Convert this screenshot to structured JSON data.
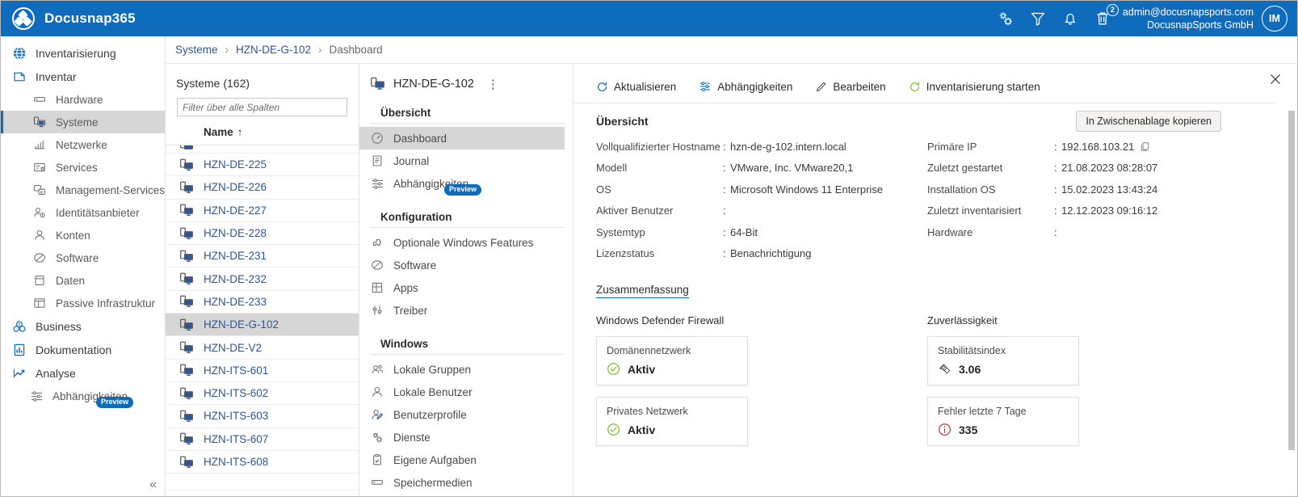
{
  "app": {
    "brand": "Docusnap365",
    "accent": "#0f6cbd"
  },
  "topbar": {
    "icons": [
      {
        "name": "settings-gear-icon",
        "label": "Einstellungen"
      },
      {
        "name": "filter-icon",
        "label": "Filter"
      },
      {
        "name": "bell-icon",
        "label": "Benachrichtigungen"
      },
      {
        "name": "trash-icon",
        "label": "Papierkorb",
        "badge": "2"
      }
    ],
    "account_email": "admin@docusnapsports.com",
    "account_company": "DocusnapSports GmbH",
    "avatar_initials": "IM"
  },
  "leftnav": {
    "items": [
      {
        "label": "Inventarisierung",
        "level": 1,
        "icon": "globe-icon",
        "selected": false
      },
      {
        "label": "Inventar",
        "level": 1,
        "icon": "inventory-icon",
        "selected": false
      },
      {
        "label": "Hardware",
        "level": 2,
        "icon": "hardware-icon",
        "selected": false
      },
      {
        "label": "Systeme",
        "level": 2,
        "icon": "system-icon",
        "selected": true
      },
      {
        "label": "Netzwerke",
        "level": 2,
        "icon": "network-icon",
        "selected": false
      },
      {
        "label": "Services",
        "level": 2,
        "icon": "services-icon",
        "selected": false
      },
      {
        "label": "Management-Services",
        "level": 2,
        "icon": "management-services-icon",
        "selected": false
      },
      {
        "label": "Identitätsanbieter",
        "level": 2,
        "icon": "identity-provider-icon",
        "selected": false
      },
      {
        "label": "Konten",
        "level": 2,
        "icon": "user-icon",
        "selected": false
      },
      {
        "label": "Software",
        "level": 2,
        "icon": "software-icon",
        "selected": false
      },
      {
        "label": "Daten",
        "level": 2,
        "icon": "data-icon",
        "selected": false
      },
      {
        "label": "Passive Infrastruktur",
        "level": 2,
        "icon": "passive-infrastructure-icon",
        "selected": false
      },
      {
        "label": "Business",
        "level": 1,
        "icon": "business-icon",
        "selected": false
      },
      {
        "label": "Dokumentation",
        "level": 1,
        "icon": "documentation-icon",
        "selected": false
      },
      {
        "label": "Analyse",
        "level": 1,
        "icon": "analysis-icon",
        "selected": false
      },
      {
        "label": "Abhängigkeiten",
        "level": 2,
        "icon": "dependencies-icon",
        "selected": false,
        "badge": "Preview"
      }
    ],
    "collapse_label": "«"
  },
  "breadcrumb": {
    "items": [
      {
        "label": "Systeme",
        "link": true
      },
      {
        "label": "HZN-DE-G-102",
        "link": true
      },
      {
        "label": "Dashboard",
        "link": false
      }
    ],
    "separator": "›"
  },
  "list_panel": {
    "title": "Systeme (162)",
    "filter_placeholder": "Filter über alle Spalten",
    "filter_value": "",
    "column_header": "Name",
    "sort_indicator": "↑",
    "rows": [
      {
        "name": "HZN-DE-225",
        "selected": false
      },
      {
        "name": "HZN-DE-226",
        "selected": false
      },
      {
        "name": "HZN-DE-227",
        "selected": false
      },
      {
        "name": "HZN-DE-228",
        "selected": false
      },
      {
        "name": "HZN-DE-231",
        "selected": false
      },
      {
        "name": "HZN-DE-232",
        "selected": false
      },
      {
        "name": "HZN-DE-233",
        "selected": false
      },
      {
        "name": "HZN-DE-G-102",
        "selected": true
      },
      {
        "name": "HZN-DE-V2",
        "selected": false
      },
      {
        "name": "HZN-ITS-601",
        "selected": false
      },
      {
        "name": "HZN-ITS-602",
        "selected": false
      },
      {
        "name": "HZN-ITS-603",
        "selected": false
      },
      {
        "name": "HZN-ITS-607",
        "selected": false
      },
      {
        "name": "HZN-ITS-608",
        "selected": false
      }
    ]
  },
  "detail_nav": {
    "header_title": "HZN-DE-G-102",
    "header_icon": "system-icon",
    "kebab": "⋮",
    "groups": [
      {
        "title": "Übersicht",
        "items": [
          {
            "label": "Dashboard",
            "icon": "dashboard-icon",
            "selected": true
          },
          {
            "label": "Journal",
            "icon": "journal-icon",
            "selected": false
          },
          {
            "label": "Abhängigkeiten",
            "icon": "dependencies-icon",
            "selected": false,
            "badge": "Preview"
          }
        ]
      },
      {
        "title": "Konfiguration",
        "items": [
          {
            "label": "Optionale Windows Features",
            "icon": "puzzle-icon",
            "selected": false
          },
          {
            "label": "Software",
            "icon": "software-icon",
            "selected": false
          },
          {
            "label": "Apps",
            "icon": "apps-icon",
            "selected": false
          },
          {
            "label": "Treiber",
            "icon": "driver-icon",
            "selected": false
          }
        ]
      },
      {
        "title": "Windows",
        "items": [
          {
            "label": "Lokale Gruppen",
            "icon": "group-icon",
            "selected": false
          },
          {
            "label": "Lokale Benutzer",
            "icon": "user-icon",
            "selected": false
          },
          {
            "label": "Benutzerprofile",
            "icon": "user-profile-icon",
            "selected": false
          },
          {
            "label": "Dienste",
            "icon": "settings-gear-icon",
            "selected": false
          },
          {
            "label": "Eigene Aufgaben",
            "icon": "clipboard-icon",
            "selected": false
          },
          {
            "label": "Speichermedien",
            "icon": "storage-icon",
            "selected": false
          }
        ]
      }
    ]
  },
  "main": {
    "close_label": "✕",
    "toolbar": [
      {
        "label": "Aktualisieren",
        "icon": "refresh-icon",
        "color": "#0f6cbd"
      },
      {
        "label": "Abhängigkeiten",
        "icon": "dependencies-icon",
        "color": "#0f6cbd"
      },
      {
        "label": "Bearbeiten",
        "icon": "pencil-icon",
        "color": "#5a5a5a"
      },
      {
        "label": "Inventarisierung starten",
        "icon": "play-refresh-icon",
        "color": "#7bbf2a"
      }
    ],
    "overview": {
      "title": "Übersicht",
      "copy_button": "In Zwischenablage kopieren",
      "left_rows": [
        {
          "key": "Vollqualifizierter Hostname",
          "value": "hzn-de-g-102.intern.local"
        },
        {
          "key": "Modell",
          "value": "VMware, Inc. VMware20,1"
        },
        {
          "key": "OS",
          "value": "Microsoft Windows 11 Enterprise"
        },
        {
          "key": "Aktiver Benutzer",
          "value": ""
        },
        {
          "key": "Systemtyp",
          "value": "64-Bit"
        },
        {
          "key": "Lizenzstatus",
          "value": "Benachrichtigung"
        }
      ],
      "right_rows": [
        {
          "key": "Primäre IP",
          "value": "192.168.103.21",
          "copyable": true
        },
        {
          "key": "Zuletzt gestartet",
          "value": "21.08.2023 08:28:07"
        },
        {
          "key": "Installation OS",
          "value": "15.02.2023 13:43:24"
        },
        {
          "key": "Zuletzt inventarisiert",
          "value": "12.12.2023 09:16:12"
        },
        {
          "key": "Hardware",
          "value": ""
        }
      ]
    },
    "summary": {
      "link_label": "Zusammenfassung",
      "columns": [
        {
          "title": "Windows Defender Firewall",
          "tiles": [
            {
              "label": "Domänennetzwerk",
              "value": "Aktiv",
              "icon": "check-circle-icon",
              "icon_color": "#7bbf2a"
            },
            {
              "label": "Privates Netzwerk",
              "value": "Aktiv",
              "icon": "check-circle-icon",
              "icon_color": "#7bbf2a"
            }
          ]
        },
        {
          "title": "Zuverlässigkeit",
          "tiles": [
            {
              "label": "Stabilitätsindex",
              "value": "3.06",
              "icon": "reliability-icon",
              "icon_color": "#4a4a4a"
            },
            {
              "label": "Fehler letzte 7 Tage",
              "value": "335",
              "icon": "info-circle-icon",
              "icon_color": "#d13438"
            }
          ]
        }
      ]
    }
  }
}
